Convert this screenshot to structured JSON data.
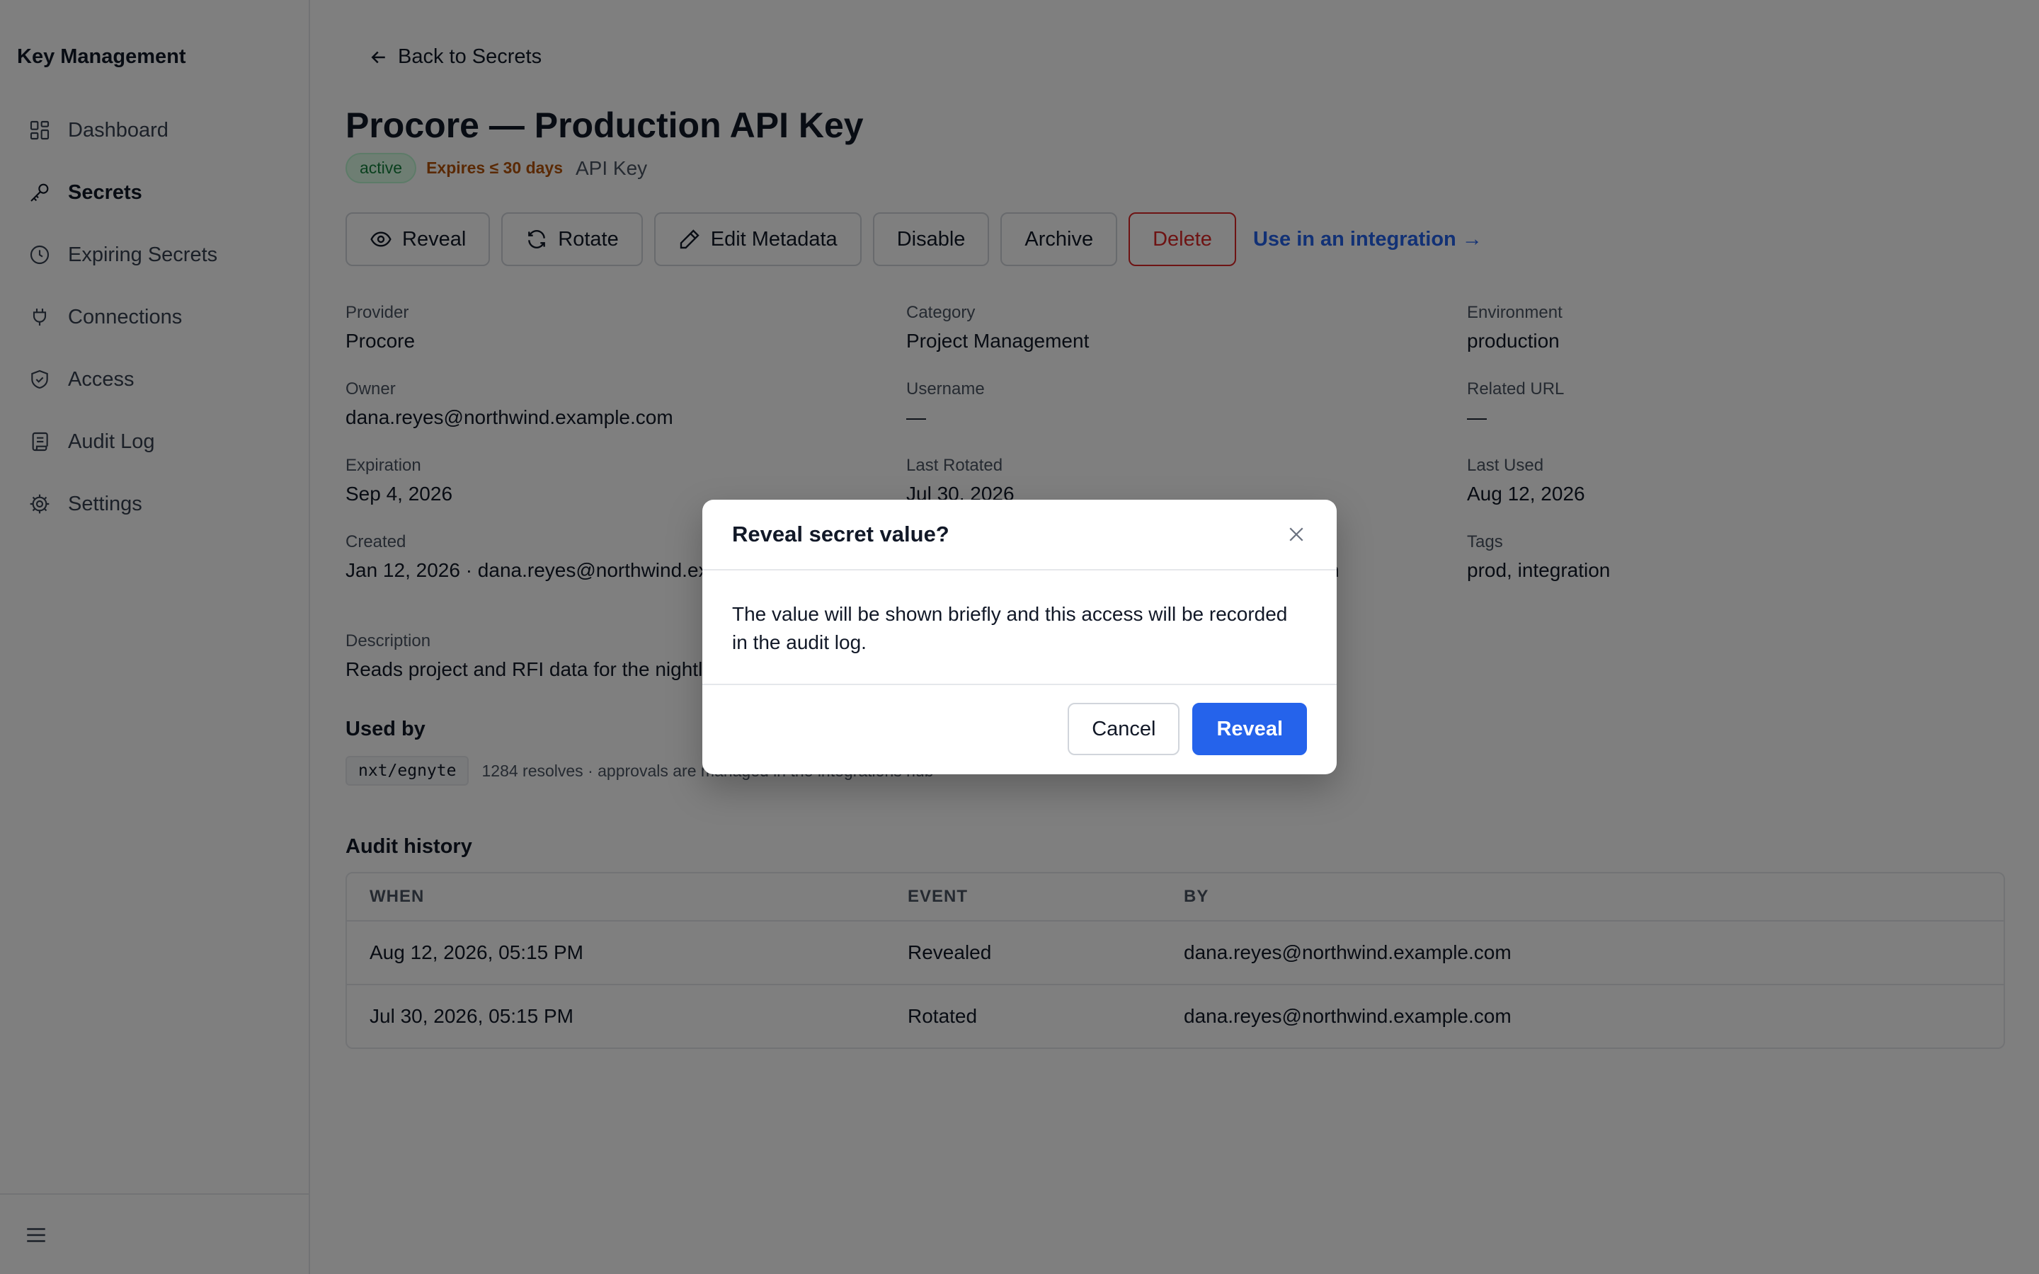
{
  "sidebar": {
    "brand": "Key Management",
    "items": [
      {
        "label": "Dashboard",
        "icon": "grid-icon"
      },
      {
        "label": "Secrets",
        "icon": "key-icon"
      },
      {
        "label": "Expiring Secrets",
        "icon": "clock-icon"
      },
      {
        "label": "Connections",
        "icon": "plug-icon"
      },
      {
        "label": "Access",
        "icon": "shield-icon"
      },
      {
        "label": "Audit Log",
        "icon": "scroll-icon"
      },
      {
        "label": "Settings",
        "icon": "gear-icon"
      }
    ],
    "active_item": "Secrets",
    "footer_icon": "menu-icon"
  },
  "header": {
    "back_label": "Back to Secrets",
    "title": "Procore — Production API Key",
    "status_badge": "active",
    "expiry_badge": "Expires ≤ 30 days",
    "type_label": "API Key"
  },
  "actions": {
    "reveal": "Reveal",
    "rotate": "Rotate",
    "edit_metadata": "Edit Metadata",
    "disable": "Disable",
    "archive": "Archive",
    "delete": "Delete",
    "integration_link": "Use in an integration →"
  },
  "fields": {
    "provider": {
      "label": "Provider",
      "value": "Procore"
    },
    "category": {
      "label": "Category",
      "value": "Project Management"
    },
    "environment": {
      "label": "Environment",
      "value": "production"
    },
    "owner": {
      "label": "Owner",
      "value": "dana.reyes@northwind.example.com"
    },
    "username": {
      "label": "Username",
      "value": "—"
    },
    "related_url": {
      "label": "Related URL",
      "value": "—"
    },
    "expiration": {
      "label": "Expiration",
      "value": "Sep 4, 2026"
    },
    "last_rotated": {
      "label": "Last Rotated",
      "value": "Jul 30, 2026"
    },
    "last_used": {
      "label": "Last Used",
      "value": "Aug 12, 2026"
    },
    "created": {
      "label": "Created",
      "value": "Jan 12, 2026 · dana.reyes@northwind.exa"
    },
    "middle_partial": {
      "value": "n"
    },
    "tags": {
      "label": "Tags",
      "value": "prod, integration"
    },
    "description": {
      "label": "Description",
      "value": "Reads project and RFI data for the nightly"
    }
  },
  "used_by": {
    "heading": "Used by",
    "chip": "nxt/egnyte",
    "note": "1284 resolves · approvals are managed in the integrations hub"
  },
  "audit": {
    "heading": "Audit history",
    "columns": [
      "WHEN",
      "EVENT",
      "BY"
    ],
    "rows": [
      {
        "when": "Aug 12, 2026, 05:15 PM",
        "event": "Revealed",
        "by": "dana.reyes@northwind.example.com"
      },
      {
        "when": "Jul 30, 2026, 05:15 PM",
        "event": "Rotated",
        "by": "dana.reyes@northwind.example.com"
      }
    ]
  },
  "modal": {
    "title": "Reveal secret value?",
    "body": "The value will be shown briefly and this access will be recorded in the audit log.",
    "cancel_label": "Cancel",
    "confirm_label": "Reveal"
  },
  "colors": {
    "primary": "#2563eb",
    "danger": "#dc2626",
    "success": "#15803d",
    "warning": "#b45309",
    "overlay": "rgba(0,0,0,0.5)"
  }
}
